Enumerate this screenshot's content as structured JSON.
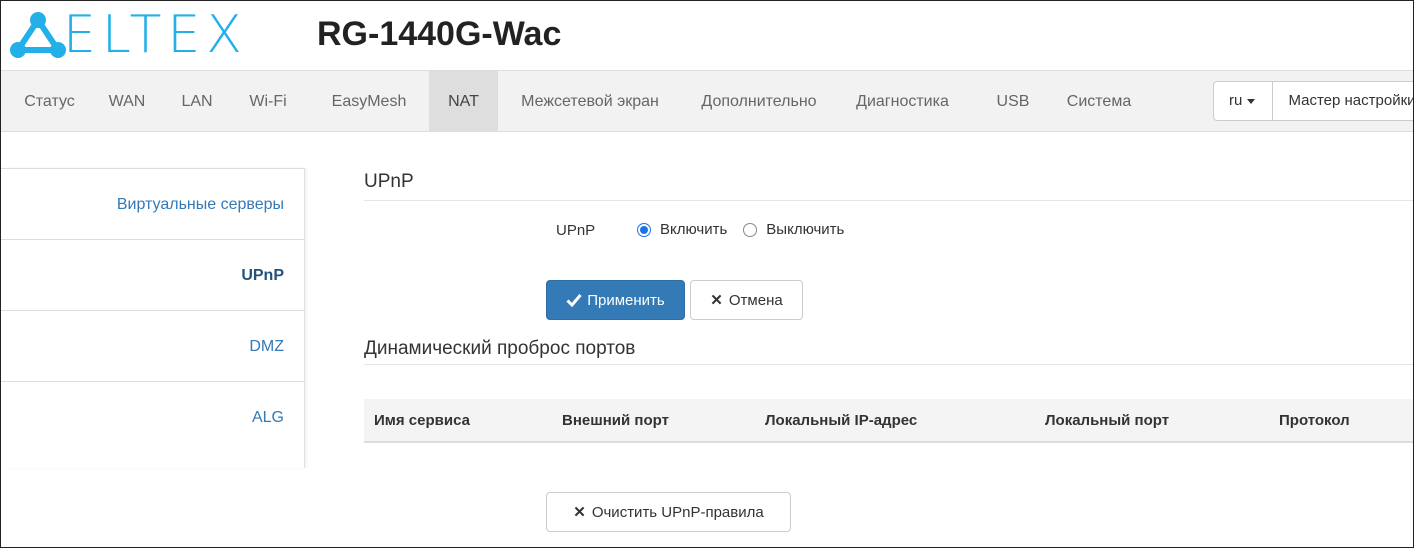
{
  "header": {
    "brand": "ELTEX",
    "device_model": "RG-1440G-Wac"
  },
  "nav": {
    "items": [
      {
        "label": "Статус"
      },
      {
        "label": "WAN"
      },
      {
        "label": "LAN"
      },
      {
        "label": "Wi-Fi"
      },
      {
        "label": "EasyMesh"
      },
      {
        "label": "NAT",
        "active": true
      },
      {
        "label": "Межсетевой экран"
      },
      {
        "label": "Дополнительно"
      },
      {
        "label": "Диагностика"
      },
      {
        "label": "USB"
      },
      {
        "label": "Система"
      }
    ],
    "language": "ru",
    "wizard_label": "Мастер настройки"
  },
  "sidebar": {
    "items": [
      {
        "label": "Виртуальные серверы"
      },
      {
        "label": "UPnP",
        "active": true
      },
      {
        "label": "DMZ"
      },
      {
        "label": "ALG"
      }
    ]
  },
  "upnp": {
    "section_title": "UPnP",
    "field_label": "UPnP",
    "option_enable": "Включить",
    "option_disable": "Выключить",
    "selected": "enable",
    "apply_label": "Применить",
    "cancel_label": "Отмена"
  },
  "ports": {
    "section_title": "Динамический проброс портов",
    "columns": [
      "Имя сервиса",
      "Внешний порт",
      "Локальный IP-адрес",
      "Локальный порт",
      "Протокол"
    ],
    "rows": [],
    "clear_label": "Очистить UPnP-правила"
  },
  "colors": {
    "brand": "#23b0e8",
    "primary": "#337ab7",
    "link": "#337ab7",
    "radio": "#1a73e8"
  },
  "icons": {
    "apply": "check-icon",
    "cancel": "close-icon",
    "clear": "close-icon",
    "language": "caret-down-icon"
  }
}
